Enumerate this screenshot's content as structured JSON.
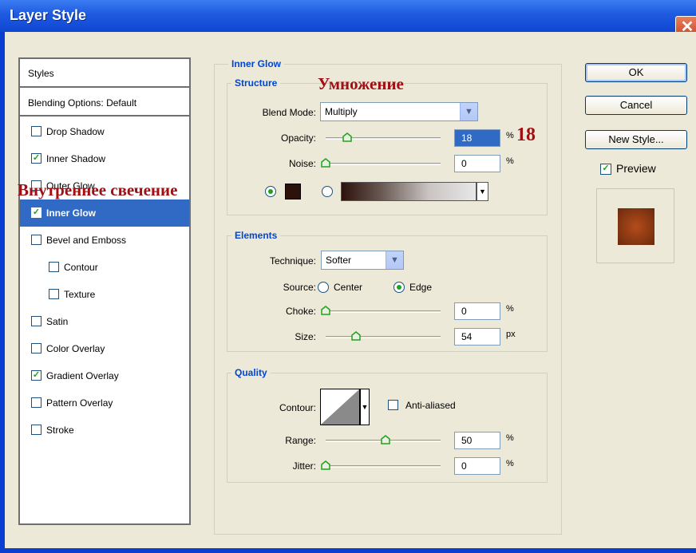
{
  "window": {
    "title": "Layer Style",
    "close_glyph": "✕"
  },
  "styles_panel": {
    "header": "Styles",
    "blending_options": "Blending Options: Default",
    "items": [
      {
        "label": "Drop Shadow",
        "checked": false
      },
      {
        "label": "Inner Shadow",
        "checked": true
      },
      {
        "label": "Outer Glow",
        "checked": false
      },
      {
        "label": "Inner Glow",
        "checked": true,
        "selected": true
      },
      {
        "label": "Bevel and Emboss",
        "checked": false
      },
      {
        "label": "Contour",
        "checked": false
      },
      {
        "label": "Texture",
        "checked": false
      },
      {
        "label": "Satin",
        "checked": false
      },
      {
        "label": "Color Overlay",
        "checked": false
      },
      {
        "label": "Gradient Overlay",
        "checked": true
      },
      {
        "label": "Pattern Overlay",
        "checked": false
      },
      {
        "label": "Stroke",
        "checked": false
      }
    ]
  },
  "inner_glow": {
    "section_title": "Inner Glow",
    "structure": {
      "title": "Structure",
      "blend_mode_label": "Blend Mode:",
      "blend_mode_value": "Multiply",
      "opacity_label": "Opacity:",
      "opacity_value": "18",
      "opacity_unit": "%",
      "noise_label": "Noise:",
      "noise_value": "0",
      "noise_unit": "%",
      "glow_color": "#2d120c"
    },
    "elements": {
      "title": "Elements",
      "technique_label": "Technique:",
      "technique_value": "Softer",
      "source_label": "Source:",
      "source_center": "Center",
      "source_edge": "Edge",
      "choke_label": "Choke:",
      "choke_value": "0",
      "choke_unit": "%",
      "size_label": "Size:",
      "size_value": "54",
      "size_unit": "px"
    },
    "quality": {
      "title": "Quality",
      "contour_label": "Contour:",
      "anti_aliased_label": "Anti-aliased",
      "range_label": "Range:",
      "range_value": "50",
      "range_unit": "%",
      "jitter_label": "Jitter:",
      "jitter_value": "0",
      "jitter_unit": "%"
    }
  },
  "buttons": {
    "ok": "OK",
    "cancel": "Cancel",
    "new_style": "New Style...",
    "preview_label": "Preview"
  },
  "annotations": {
    "multiply_ru": "Умножение",
    "opacity_ru": "18",
    "inner_glow_ru": "Внутреннее свечение"
  },
  "colors": {
    "title_bar": "#0f47d2",
    "selection": "#316ac5",
    "annotation": "#a00f14",
    "group_label": "#0046d5"
  }
}
